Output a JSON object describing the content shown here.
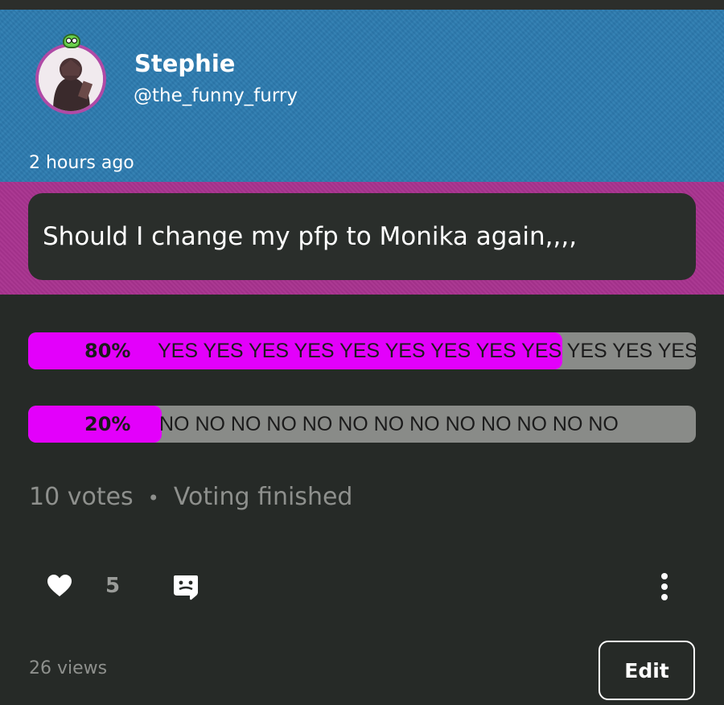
{
  "post": {
    "author_name": "Stephie",
    "author_handle": "@the_funny_furry",
    "time": "2 hours ago",
    "question": "Should I change my pfp to Monika again,,,,"
  },
  "poll": {
    "options": [
      {
        "percent_label": "80%",
        "label": "YES YES YES YES YES YES YES YES YES YES YES YES",
        "percent": 80
      },
      {
        "percent_label": "20%",
        "label": "NO NO NO NO NO NO NO NO NO NO NO NO NO",
        "percent": 20
      }
    ],
    "votes": "10 votes",
    "separator": "•",
    "status": "Voting finished",
    "fill_color": "#e300fb",
    "track_color": "#898b88"
  },
  "actions": {
    "likes": "5",
    "views": "26 views",
    "edit_label": "Edit",
    "icons": [
      "heart-icon",
      "comment-icon",
      "more-vertical-icon"
    ]
  },
  "colors": {
    "header_blue": "#2c7bb0",
    "band_pink": "#a8338f",
    "background": "#262a27"
  }
}
